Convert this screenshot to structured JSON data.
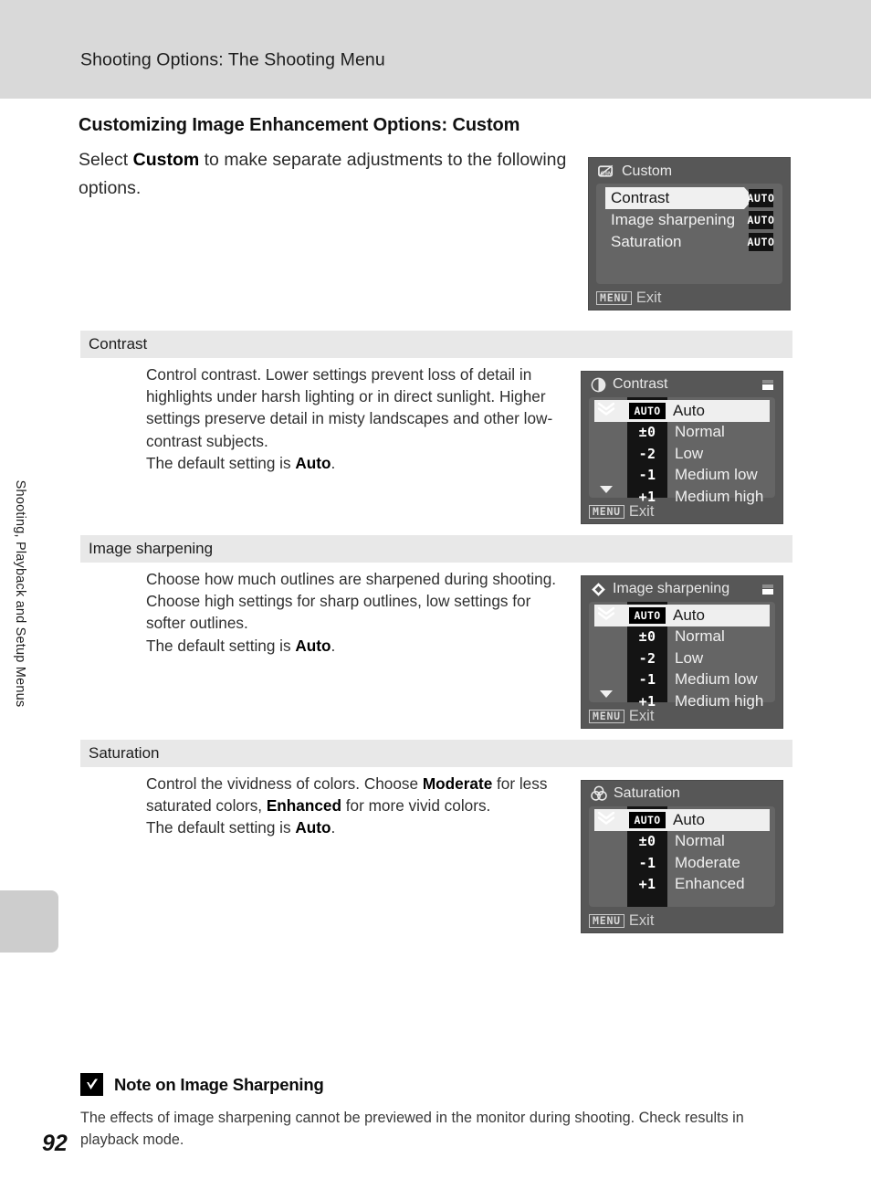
{
  "header": {
    "running_title": "Shooting Options: The Shooting Menu"
  },
  "sidebar": {
    "vertical_label": "Shooting, Playback and Setup Menus"
  },
  "page": {
    "number": "92",
    "heading": "Customizing Image Enhancement Options: Custom",
    "intro_html": "Select <b>Custom</b> to make separate adjustments to the following options."
  },
  "sections": [
    {
      "title": "Contrast",
      "body_html": "Control contrast. Lower settings prevent loss of detail in highlights under harsh lighting or in direct sunlight. Higher settings preserve detail in misty landscapes and other low-contrast subjects.<br>The default setting is <b>Auto</b>."
    },
    {
      "title": "Image sharpening",
      "body_html": "Choose how much outlines are sharpened during shooting. Choose high settings for sharp outlines, low settings for softer outlines.<br>The default setting is <b>Auto</b>."
    },
    {
      "title": "Saturation",
      "body_html": "Control the vividness of colors. Choose <b>Moderate</b> for less saturated colors, <b>Enhanced</b> for more vivid colors.<br>The default setting is <b>Auto</b>."
    }
  ],
  "screens": {
    "custom_menu": {
      "title": "Custom",
      "title_icon": "csm-icon",
      "exit_key": "MENU",
      "exit_label": "Exit",
      "rows": [
        {
          "label": "Contrast",
          "badge": "AUTO",
          "selected": true
        },
        {
          "label": "Image sharpening",
          "badge": "AUTO",
          "selected": false
        },
        {
          "label": "Saturation",
          "badge": "AUTO",
          "selected": false
        }
      ]
    },
    "contrast": {
      "title": "Contrast",
      "title_icon": "half-circle-icon",
      "exit_key": "MENU",
      "exit_label": "Exit",
      "has_scroll_up": true,
      "has_scroll_down": true,
      "options": [
        {
          "value": "AUTO",
          "label": "Auto",
          "selected": true,
          "is_badge": true
        },
        {
          "value": "±0",
          "label": "Normal",
          "selected": false,
          "is_badge": false
        },
        {
          "value": "-2",
          "label": "Low",
          "selected": false,
          "is_badge": false
        },
        {
          "value": "-1",
          "label": "Medium low",
          "selected": false,
          "is_badge": false
        },
        {
          "value": "+1",
          "label": "Medium high",
          "selected": false,
          "is_badge": false
        }
      ]
    },
    "image_sharpening": {
      "title": "Image sharpening",
      "title_icon": "diamond-icon",
      "exit_key": "MENU",
      "exit_label": "Exit",
      "has_scroll_up": true,
      "has_scroll_down": true,
      "options": [
        {
          "value": "AUTO",
          "label": "Auto",
          "selected": true,
          "is_badge": true
        },
        {
          "value": "±0",
          "label": "Normal",
          "selected": false,
          "is_badge": false
        },
        {
          "value": "-2",
          "label": "Low",
          "selected": false,
          "is_badge": false
        },
        {
          "value": "-1",
          "label": "Medium low",
          "selected": false,
          "is_badge": false
        },
        {
          "value": "+1",
          "label": "Medium high",
          "selected": false,
          "is_badge": false
        }
      ]
    },
    "saturation": {
      "title": "Saturation",
      "title_icon": "venn-circles-icon",
      "exit_key": "MENU",
      "exit_label": "Exit",
      "has_scroll_up": true,
      "has_scroll_down": false,
      "options": [
        {
          "value": "AUTO",
          "label": "Auto",
          "selected": true,
          "is_badge": true
        },
        {
          "value": "±0",
          "label": "Normal",
          "selected": false,
          "is_badge": false
        },
        {
          "value": "-1",
          "label": "Moderate",
          "selected": false,
          "is_badge": false
        },
        {
          "value": "+1",
          "label": "Enhanced",
          "selected": false,
          "is_badge": false
        }
      ]
    }
  },
  "note": {
    "icon": "caution-check-icon",
    "title": "Note on Image Sharpening",
    "body": "The effects of image sharpening cannot be previewed in the monitor during shooting. Check results in playback mode."
  },
  "colors": {
    "header_band": "#d9d9d9",
    "subsection_bar": "#e8e8e8",
    "lcd_background": "#575757",
    "lcd_panel": "#656565",
    "highlight": "#f0f0f0"
  }
}
